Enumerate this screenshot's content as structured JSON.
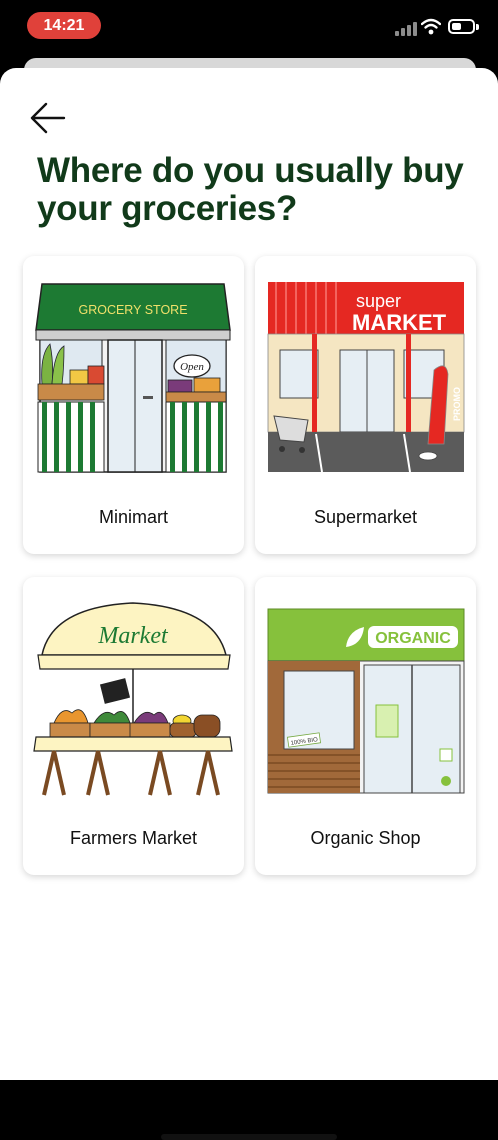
{
  "status_bar": {
    "time": "14:21"
  },
  "header": {
    "title": "Where do you usually buy your groceries?"
  },
  "options": [
    {
      "label": "Minimart",
      "sign": "GROCERY STORE",
      "door_sign": "Open"
    },
    {
      "label": "Supermarket",
      "sign_top": "super",
      "sign_bottom": "MARKET",
      "flag": "PROMO"
    },
    {
      "label": "Farmers Market",
      "canopy": "Market"
    },
    {
      "label": "Organic Shop",
      "sign": "ORGANIC",
      "sticker": "100% BIO"
    }
  ],
  "colors": {
    "title": "#113a1a",
    "time_pill": "#e0413a",
    "awning_green": "#1d7a33",
    "supermarket_red": "#e52822",
    "organic_green": "#86c13c"
  }
}
